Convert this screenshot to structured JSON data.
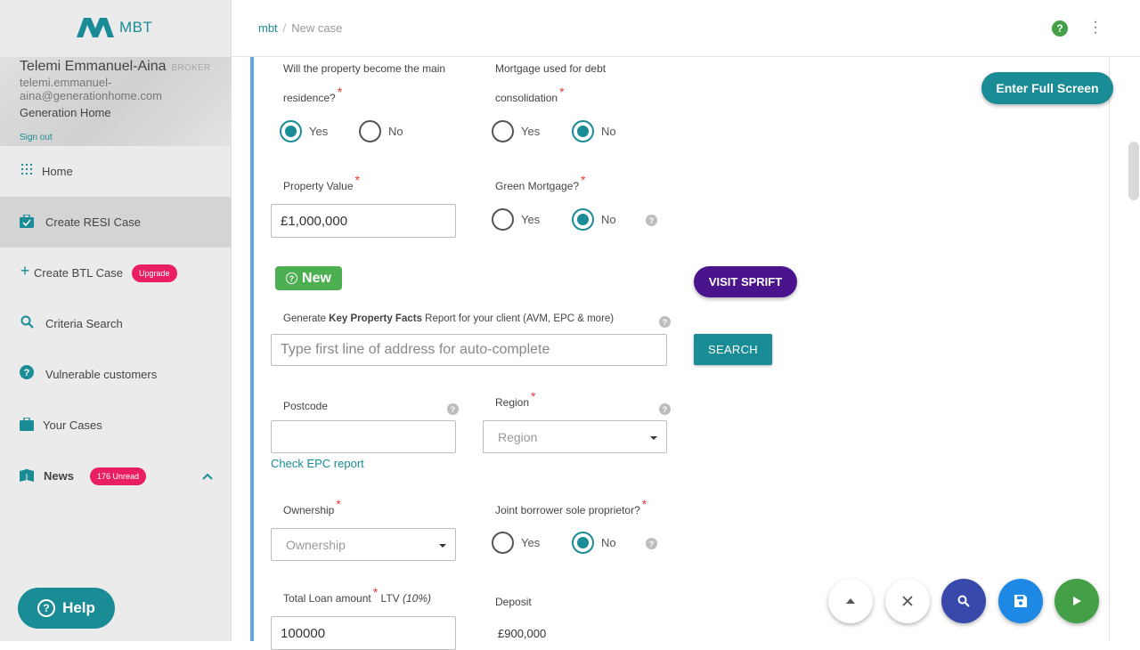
{
  "app": {
    "logo_text": "MBT"
  },
  "profile": {
    "name": "Telemi Emmanuel-Aina",
    "role": "BROKER",
    "email": "telemi.emmanuel-aina@generationhome.com",
    "company": "Generation Home",
    "signout": "Sign out"
  },
  "sidebar": {
    "items": [
      {
        "label": "Home",
        "icon": "grid-icon"
      },
      {
        "label": "Create RESI Case",
        "icon": "briefcase-check-icon"
      },
      {
        "label": "Create BTL Case",
        "icon": "plus-icon",
        "badge": "Upgrade"
      },
      {
        "label": "Criteria Search",
        "icon": "search-icon"
      },
      {
        "label": "Vulnerable customers",
        "icon": "help-circle-icon"
      },
      {
        "label": "Your Cases",
        "icon": "briefcase-icon"
      },
      {
        "label": "News",
        "icon": "book-icon",
        "badge": "176 Unread"
      }
    ],
    "help_label": "Help"
  },
  "header": {
    "breadcrumb_root": "mbt",
    "breadcrumb_sep": "/",
    "breadcrumb_current": "New case"
  },
  "form": {
    "main_residence_label_1": "Will the property become the main",
    "main_residence_label_2": "residence?",
    "debt_label_1": "Mortgage used for debt",
    "debt_label_2": "consolidation",
    "yes": "Yes",
    "no": "No",
    "property_value_label": "Property Value",
    "property_value": "£1,000,000",
    "green_label": "Green Mortgage?",
    "new_tag": "New",
    "visit_label": "VISIT SPRIFT",
    "kpf_prefix": "Generate ",
    "kpf_bold": "Key Property Facts",
    "kpf_suffix": " Report for your client (AVM, EPC & more)",
    "address_placeholder": "Type first line of address for auto-complete",
    "search_label": "SEARCH",
    "postcode_label": "Postcode",
    "region_label": "Region",
    "region_placeholder": "Region",
    "epc_link": "Check EPC report",
    "ownership_label": "Ownership",
    "ownership_placeholder": "Ownership",
    "joint_label": "Joint borrower sole proprietor?",
    "loan_label": "Total Loan amount",
    "ltv_label": "LTV",
    "ltv_value": "(10%)",
    "loan_value": "100000",
    "deposit_label": "Deposit",
    "deposit_value": "£900,000",
    "fullscreen_label": "Enter Full Screen"
  },
  "colors": {
    "accent": "#1a8c95",
    "purple": "#4a148c",
    "green": "#43a047",
    "blue": "#1e88e5",
    "navy": "#3949ab"
  }
}
